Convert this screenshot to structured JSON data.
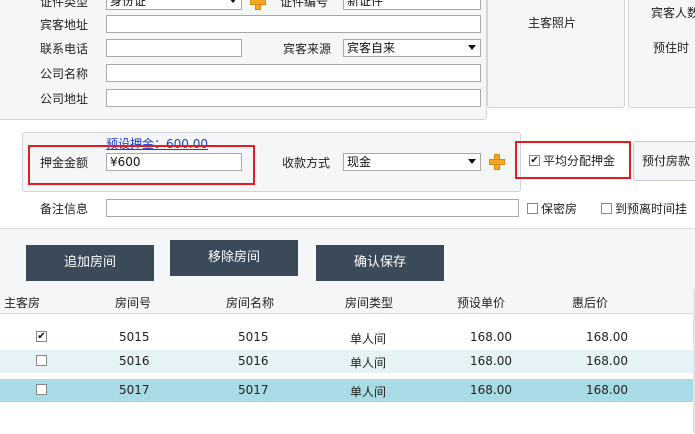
{
  "guest_info": {
    "id_type_label": "证件类型",
    "id_type_value": "身份证",
    "id_no_label": "证件编号",
    "id_no_value": "新证件",
    "guest_address_label": "宾客地址",
    "guest_address_value": "",
    "phone_label": "联系电话",
    "phone_value": "",
    "source_label": "宾客来源",
    "source_value": "宾客自来",
    "company_name_label": "公司名称",
    "company_name_value": "",
    "company_address_label": "公司地址",
    "company_address_value": ""
  },
  "photo_panel": {
    "label": "主客照片"
  },
  "right_panel": {
    "guest_count_label": "宾客人数",
    "expected_label": "预住时"
  },
  "deposit": {
    "preset_link": "预设押金：600.00",
    "amount_label": "押金金额",
    "amount_value": "¥600",
    "payment_label": "收款方式",
    "payment_value": "现金",
    "split_label": "平均分配押金",
    "split_checked": "✔",
    "prepay_button": "预付房款"
  },
  "remarks": {
    "label": "备注信息",
    "value": "",
    "confidential_label": "保密房",
    "checkout_label": "到预离时间挂"
  },
  "actions": {
    "add_room": "追加房间",
    "remove_room": "移除房间",
    "confirm_save": "确认保存"
  },
  "table": {
    "headers": [
      "主客房",
      "房间号",
      "房间名称",
      "房间类型",
      "预设单价",
      "惠后价"
    ],
    "rows": [
      {
        "main": "✔",
        "room_no": "5015",
        "room_name": "5015",
        "room_type": "单人间",
        "preset_price": "168.00",
        "discount_price": "168.00"
      },
      {
        "main": "",
        "room_no": "5016",
        "room_name": "5016",
        "room_type": "单人间",
        "preset_price": "168.00",
        "discount_price": "168.00"
      },
      {
        "main": "",
        "room_no": "5017",
        "room_name": "5017",
        "room_type": "单人间",
        "preset_price": "168.00",
        "discount_price": "168.00"
      }
    ]
  }
}
